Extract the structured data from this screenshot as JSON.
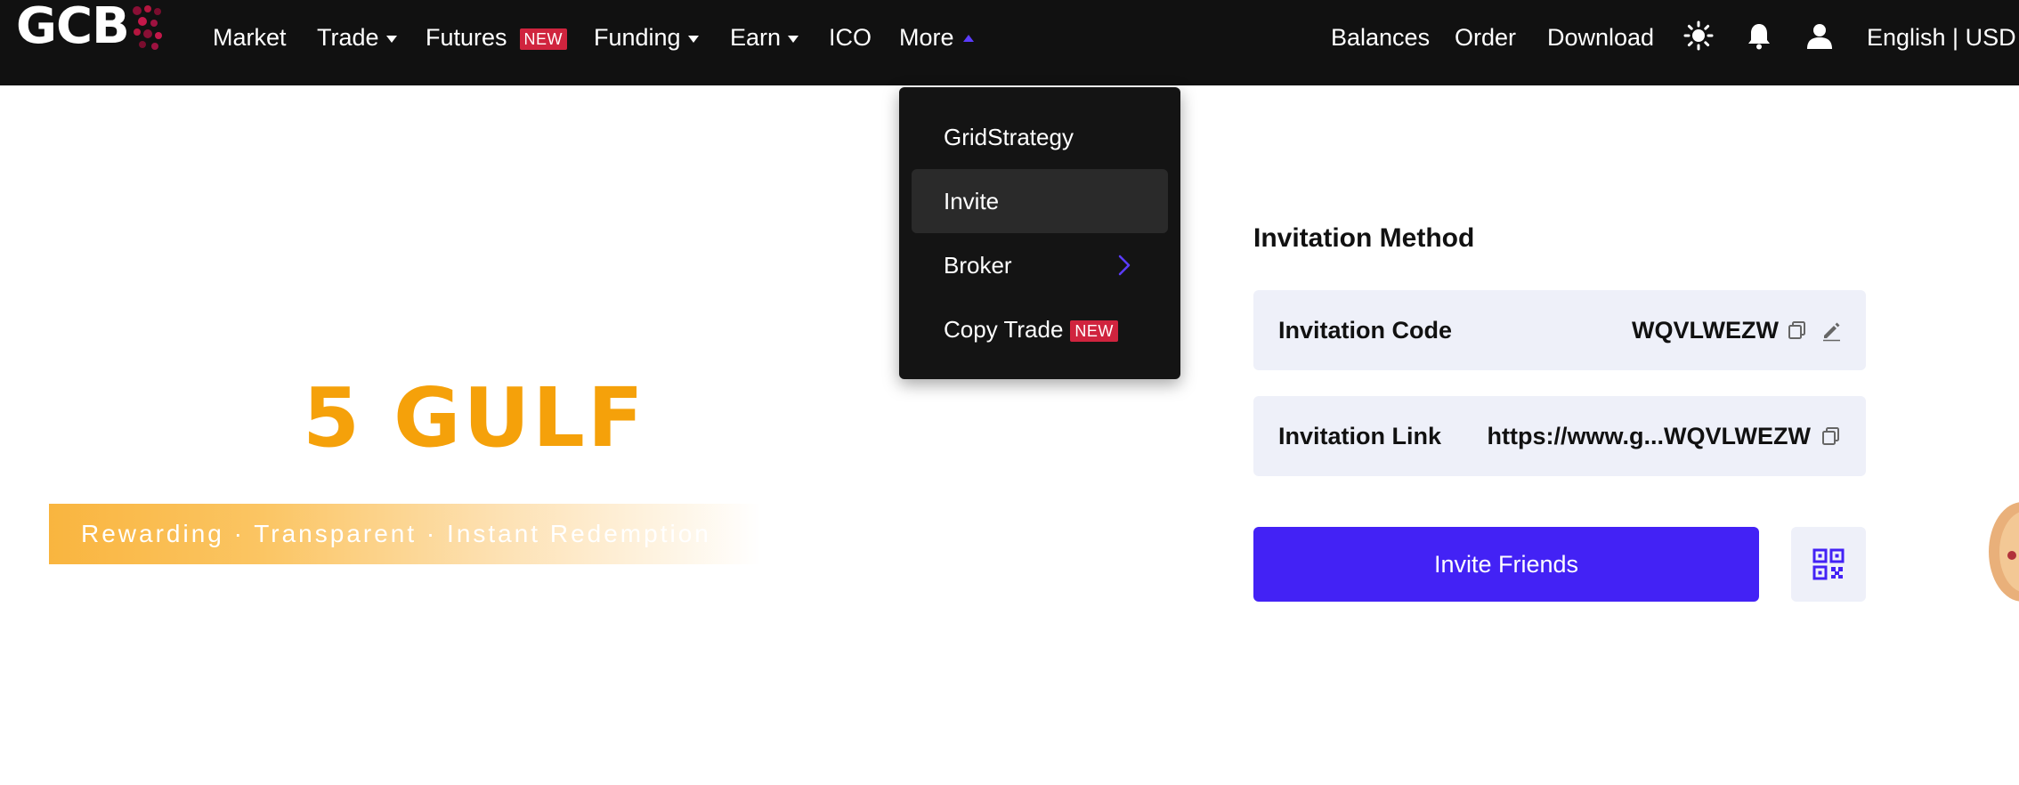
{
  "colors": {
    "nav_background": "#111111",
    "accent_purple": "#4322f5",
    "badge_red": "#d0243e",
    "promo_orange": "#f5a10a",
    "panel_bg": "#eef0f9"
  },
  "logo": {
    "text": "GCB"
  },
  "nav": {
    "items": [
      {
        "label": "Market",
        "has_caret": false
      },
      {
        "label": "Trade",
        "has_caret": true
      },
      {
        "label": "Futures",
        "badge": "NEW"
      },
      {
        "label": "Funding",
        "has_caret": true
      },
      {
        "label": "Earn",
        "has_caret": true
      },
      {
        "label": "ICO",
        "has_caret": false
      },
      {
        "label": "More",
        "expanded": true
      }
    ],
    "right": {
      "balances": "Balances",
      "order": "Order",
      "download": "Download",
      "icons": [
        "sun-icon",
        "bell-icon",
        "user-icon"
      ],
      "locale": "English | USD"
    }
  },
  "more_menu": {
    "items": [
      {
        "label": "GridStrategy"
      },
      {
        "label": "Invite",
        "active": true
      },
      {
        "label": "Broker",
        "has_submenu": true
      },
      {
        "label": "Copy Trade",
        "badge": "NEW"
      }
    ]
  },
  "promo": {
    "title": "5 GULF",
    "tagline": "Rewarding · Transparent · Instant Redemption"
  },
  "invitation": {
    "title": "Invitation Method",
    "code_label": "Invitation Code",
    "code_value": "WQVLWEZW",
    "link_label": "Invitation Link",
    "link_value": "https://www.g...WQVLWEZW",
    "invite_button": "Invite Friends",
    "qr_icon": "qr-code-icon"
  }
}
